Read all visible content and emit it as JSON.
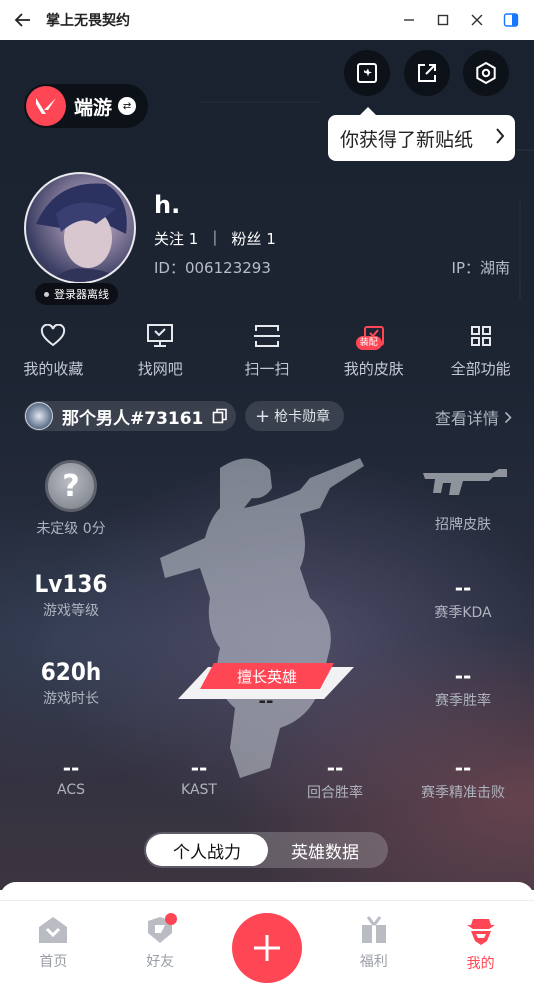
{
  "window": {
    "title": "掌上无畏契约",
    "back_icon": "arrow-left-icon",
    "minimize_icon": "minimize-icon",
    "maximize_icon": "maximize-icon",
    "close_icon": "close-icon",
    "sidebar_icon": "sidebar-toggle-icon"
  },
  "header": {
    "brand_name": "端游",
    "brand_color": "#ff4655",
    "tooltip_text": "你获得了新贴纸",
    "icons": [
      "sticker-icon",
      "share-icon",
      "settings-icon"
    ]
  },
  "profile": {
    "username": "h.",
    "follow_label": "关注",
    "follow_count": "1",
    "separator": "|",
    "fans_label": "粉丝",
    "fans_count": "1",
    "id_text": "ID：006123293",
    "ip_text": "IP：湖南",
    "status": "登录器离线"
  },
  "features": [
    {
      "label": "我的收藏",
      "icon": "heart-icon"
    },
    {
      "label": "找网吧",
      "icon": "monitor-icon"
    },
    {
      "label": "扫一扫",
      "icon": "scan-icon"
    },
    {
      "label": "我的皮肤",
      "icon": "skin-icon",
      "badge": "装配"
    },
    {
      "label": "全部功能",
      "icon": "grid-icon"
    }
  ],
  "player": {
    "name": "那个男人#73161",
    "medal_label": "枪卡勋章",
    "details_label": "查看详情"
  },
  "stats": {
    "rank_label": "未定级 0分",
    "rank_symbol": "?",
    "weapon_label": "招牌皮肤",
    "level_value": "Lv136",
    "level_label": "游戏等级",
    "kda_value": "--",
    "kda_label": "赛季KDA",
    "time_value": "620h",
    "time_label": "游戏时长",
    "winrate_value": "--",
    "winrate_label": "赛季胜率",
    "hero_tag": "擅长英雄",
    "hero_value": "--",
    "acs_value": "--",
    "acs_label": "ACS",
    "kast_value": "--",
    "kast_label": "KAST",
    "round_value": "--",
    "round_label": "回合胜率",
    "precise_value": "--",
    "precise_label": "赛季精准击败"
  },
  "toggle": {
    "active": "个人战力",
    "inactive": "英雄数据"
  },
  "tabbar": [
    {
      "label": "首页",
      "icon": "home-icon"
    },
    {
      "label": "好友",
      "icon": "friends-icon",
      "has_dot": true
    },
    {
      "label": "",
      "icon": "plus-icon"
    },
    {
      "label": "福利",
      "icon": "gift-icon"
    },
    {
      "label": "我的",
      "icon": "profile-icon",
      "active": true
    }
  ]
}
